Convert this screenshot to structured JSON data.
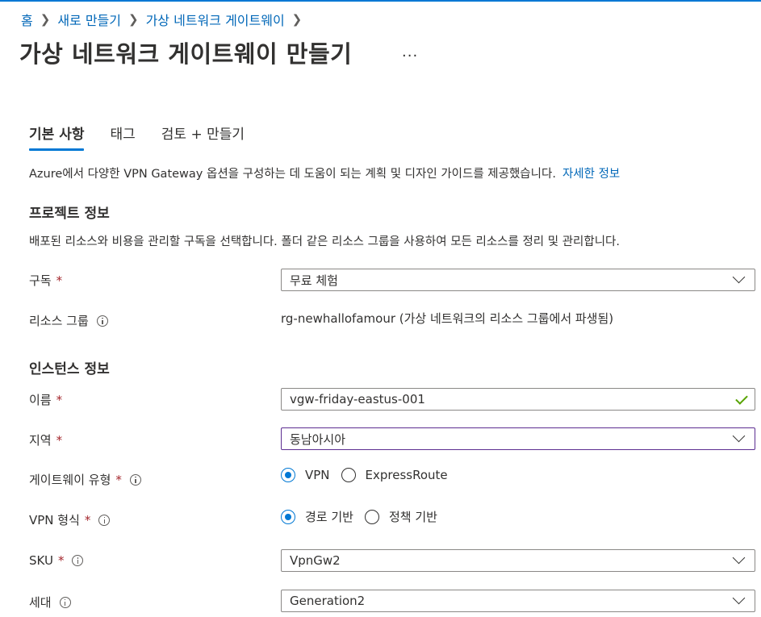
{
  "breadcrumb": [
    "홈",
    "새로 만들기",
    "가상 네트워크 게이트웨이"
  ],
  "page_title": "가상 네트워크 게이트웨이 만들기",
  "more_label": "...",
  "tabs": [
    {
      "label": "기본 사항",
      "active": true
    },
    {
      "label": "태그",
      "active": false
    },
    {
      "label": "검토 + 만들기",
      "active": false
    }
  ],
  "intro": {
    "text": "Azure에서 다양한 VPN Gateway 옵션을 구성하는 데 도움이 되는 계획 및 디자인 가이드를 제공했습니다.",
    "link": "자세한 정보"
  },
  "project": {
    "title": "프로젝트 정보",
    "desc": "배포된 리소스와 비용을 관리할 구독을 선택합니다. 폴더 같은 리소스 그룹을 사용하여 모든 리소스를 정리 및 관리합니다.",
    "subscription": {
      "label": "구독",
      "required": "*",
      "value": "무료 체험"
    },
    "resource_group": {
      "label": "리소스 그룹",
      "value": "rg-newhallofamour (가상 네트워크의 리소스 그룹에서 파생됨)"
    }
  },
  "instance": {
    "title": "인스턴스 정보",
    "name": {
      "label": "이름",
      "required": "*",
      "value": "vgw-friday-eastus-001"
    },
    "region": {
      "label": "지역",
      "required": "*",
      "value": "동남아시아"
    },
    "gateway_type": {
      "label": "게이트웨이 유형",
      "required": "*",
      "options": [
        "VPN",
        "ExpressRoute"
      ],
      "selected": "VPN"
    },
    "vpn_type": {
      "label": "VPN 형식",
      "required": "*",
      "options": [
        "경로 기반",
        "정책 기반"
      ],
      "selected": "경로 기반"
    },
    "sku": {
      "label": "SKU",
      "required": "*",
      "value": "VpnGw2"
    },
    "generation": {
      "label": "세대",
      "value": "Generation2"
    }
  },
  "colors": {
    "accent": "#0078d4",
    "link": "#0067b8",
    "required": "#a4262c",
    "valid": "#57a300",
    "focus_border": "#5c2d91"
  }
}
